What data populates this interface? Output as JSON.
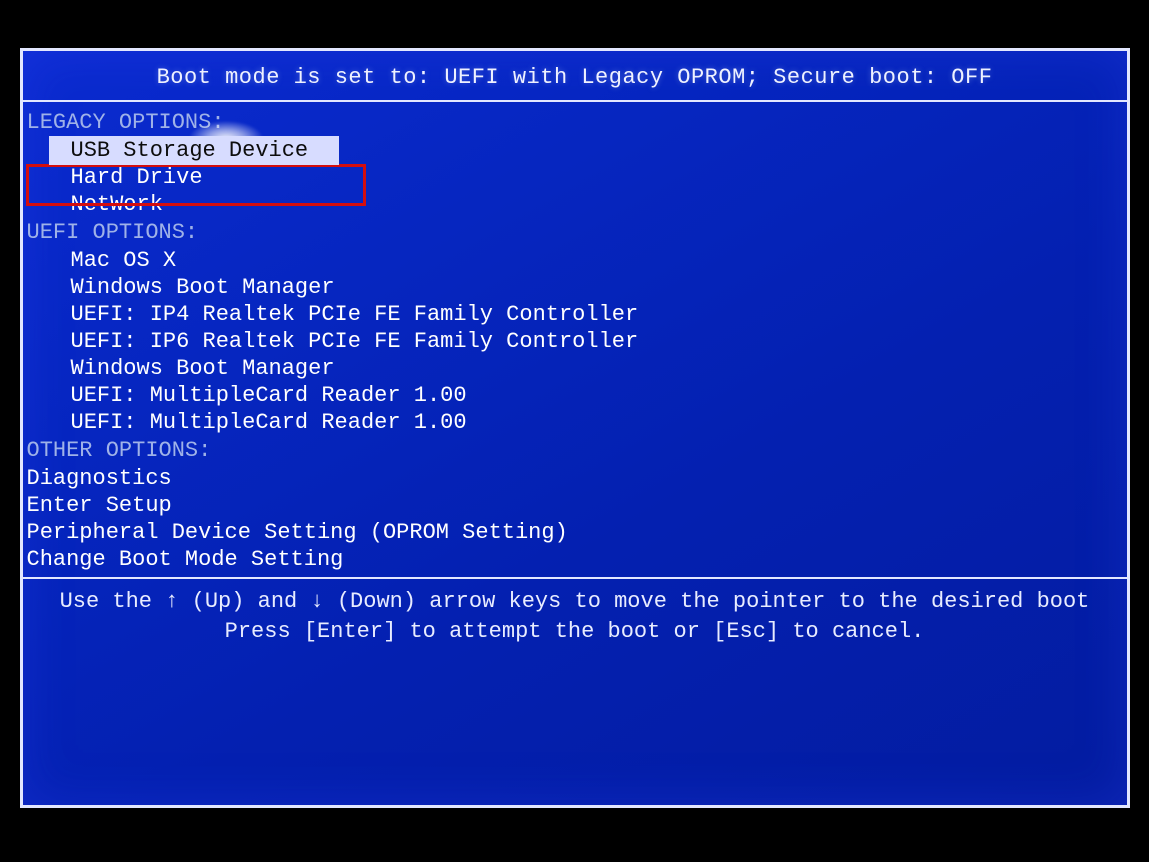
{
  "header": {
    "text": "Boot mode is set to: UEFI with Legacy OPROM; Secure boot: OFF"
  },
  "sections": {
    "legacy": {
      "label": "LEGACY OPTIONS:",
      "items": [
        {
          "label": "USB Storage Device",
          "selected": true
        },
        {
          "label": "Hard Drive",
          "selected": false
        },
        {
          "label": "NetWork",
          "selected": false
        }
      ]
    },
    "uefi": {
      "label": "UEFI OPTIONS:",
      "items": [
        {
          "label": "Mac OS X"
        },
        {
          "label": "Windows Boot Manager"
        },
        {
          "label": "UEFI: IP4 Realtek PCIe FE Family Controller"
        },
        {
          "label": "UEFI: IP6 Realtek PCIe FE Family Controller"
        },
        {
          "label": "Windows Boot Manager"
        },
        {
          "label": "UEFI: MultipleCard Reader 1.00"
        },
        {
          "label": "UEFI: MultipleCard Reader 1.00"
        }
      ]
    },
    "other": {
      "label": "OTHER OPTIONS:",
      "items": [
        {
          "label": "Diagnostics"
        },
        {
          "label": "Enter Setup"
        },
        {
          "label": "Peripheral Device Setting (OPROM Setting)"
        },
        {
          "label": "Change Boot Mode Setting"
        }
      ]
    }
  },
  "footer": {
    "line1_a": "Use the ",
    "line1_b": " (Up) and ",
    "line1_c": " (Down) arrow keys to move the pointer to the desired boot",
    "line2": "Press [Enter] to attempt the boot or [Esc] to cancel.",
    "up_glyph": "↑",
    "down_glyph": "↓"
  }
}
